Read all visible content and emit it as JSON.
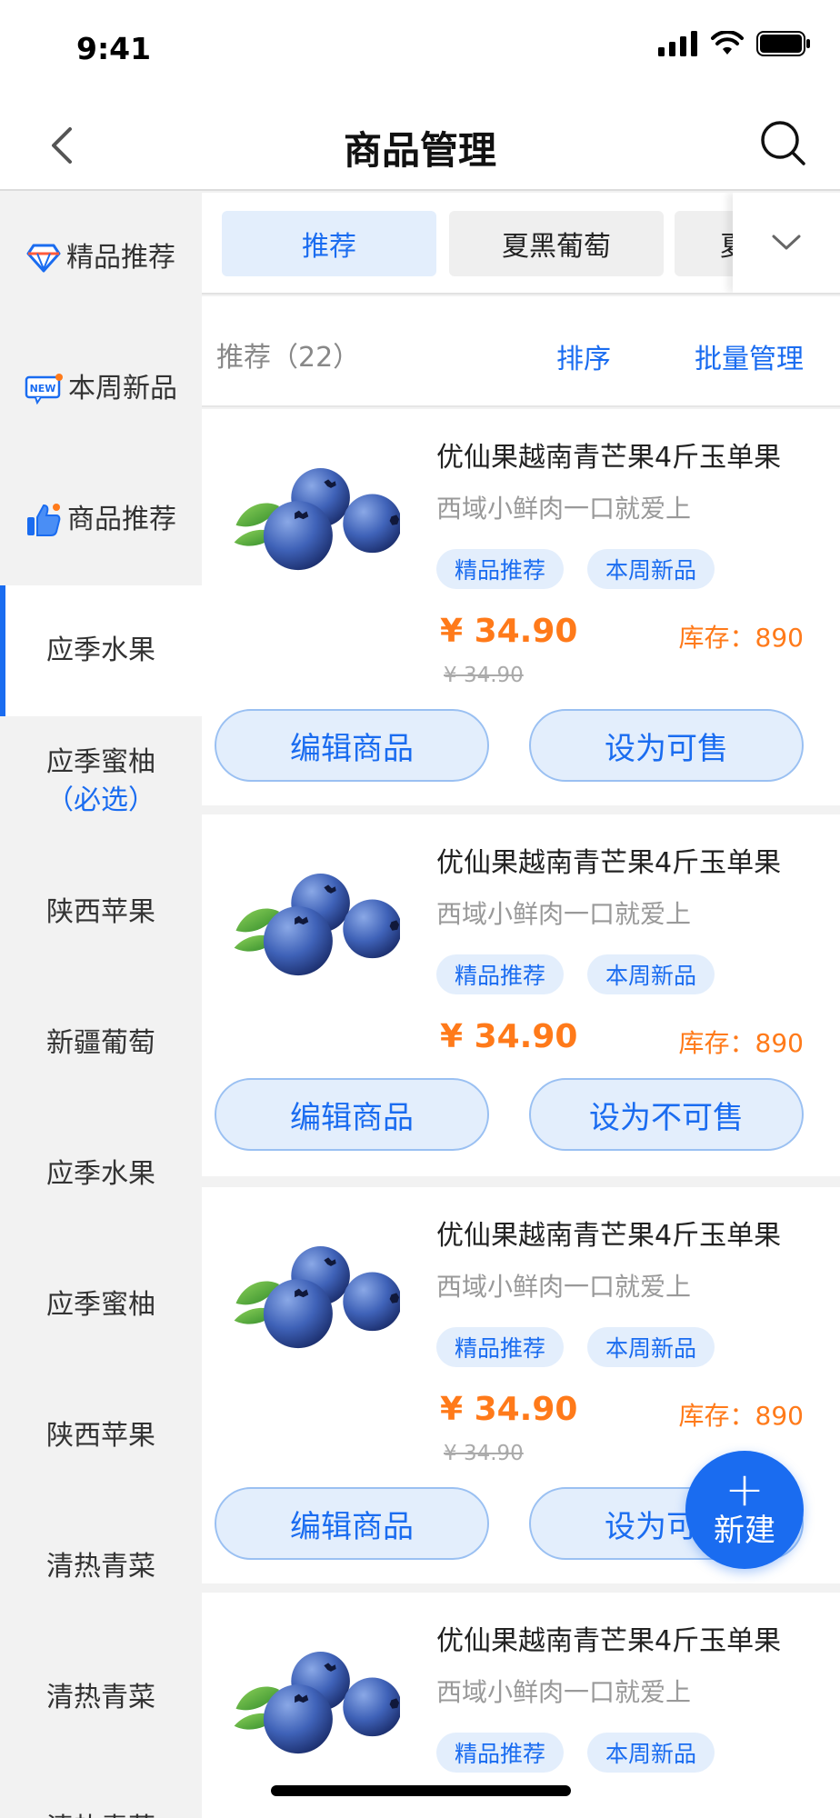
{
  "status_bar": {
    "time": "9:41"
  },
  "header": {
    "title": "商品管理"
  },
  "sidebar": {
    "items": [
      {
        "label": "精品推荐",
        "icon": "diamond-icon"
      },
      {
        "label": "本周新品",
        "icon": "new-badge-icon"
      },
      {
        "label": "商品推荐",
        "icon": "thumbs-up-icon"
      },
      {
        "label": "应季水果",
        "active": true
      },
      {
        "label": "应季蜜柚",
        "sub": "（必选）"
      },
      {
        "label": "陕西苹果"
      },
      {
        "label": "新疆葡萄"
      },
      {
        "label": "应季水果"
      },
      {
        "label": "应季蜜柚"
      },
      {
        "label": "陕西苹果"
      },
      {
        "label": "清热青菜"
      },
      {
        "label": "清热青菜"
      },
      {
        "label": "清热青菜"
      }
    ]
  },
  "tabs": [
    {
      "label": "推荐",
      "active": true
    },
    {
      "label": "夏黑葡萄"
    },
    {
      "label": "夏黑葡萄"
    }
  ],
  "list_header": {
    "count_label": "推荐（22）",
    "sort_label": "排序",
    "batch_label": "批量管理"
  },
  "products": [
    {
      "title": "优仙果越南青芒果4斤玉单果",
      "subtitle": "西域小鲜肉一口就爱上",
      "tags": [
        "精品推荐",
        "本周新品"
      ],
      "price": "¥ 34.90",
      "old_price": "¥ 34.90",
      "stock": "库存：890",
      "edit_label": "编辑商品",
      "action_label": "设为可售"
    },
    {
      "title": "优仙果越南青芒果4斤玉单果",
      "subtitle": "西域小鲜肉一口就爱上",
      "tags": [
        "精品推荐",
        "本周新品"
      ],
      "price": "¥ 34.90",
      "stock": "库存：890",
      "edit_label": "编辑商品",
      "action_label": "设为不可售"
    },
    {
      "title": "优仙果越南青芒果4斤玉单果",
      "subtitle": "西域小鲜肉一口就爱上",
      "tags": [
        "精品推荐",
        "本周新品"
      ],
      "price": "¥ 34.90",
      "old_price": "¥ 34.90",
      "stock": "库存：890",
      "edit_label": "编辑商品",
      "action_label": "设为可售"
    },
    {
      "title": "优仙果越南青芒果4斤玉单果",
      "subtitle": "西域小鲜肉一口就爱上",
      "tags": [
        "精品推荐",
        "本周新品"
      ]
    }
  ],
  "fab": {
    "plus": "+",
    "label": "新建"
  },
  "colors": {
    "primary": "#1a6cf0",
    "price": "#ff7a1a",
    "tag_bg": "#e3eefc"
  }
}
